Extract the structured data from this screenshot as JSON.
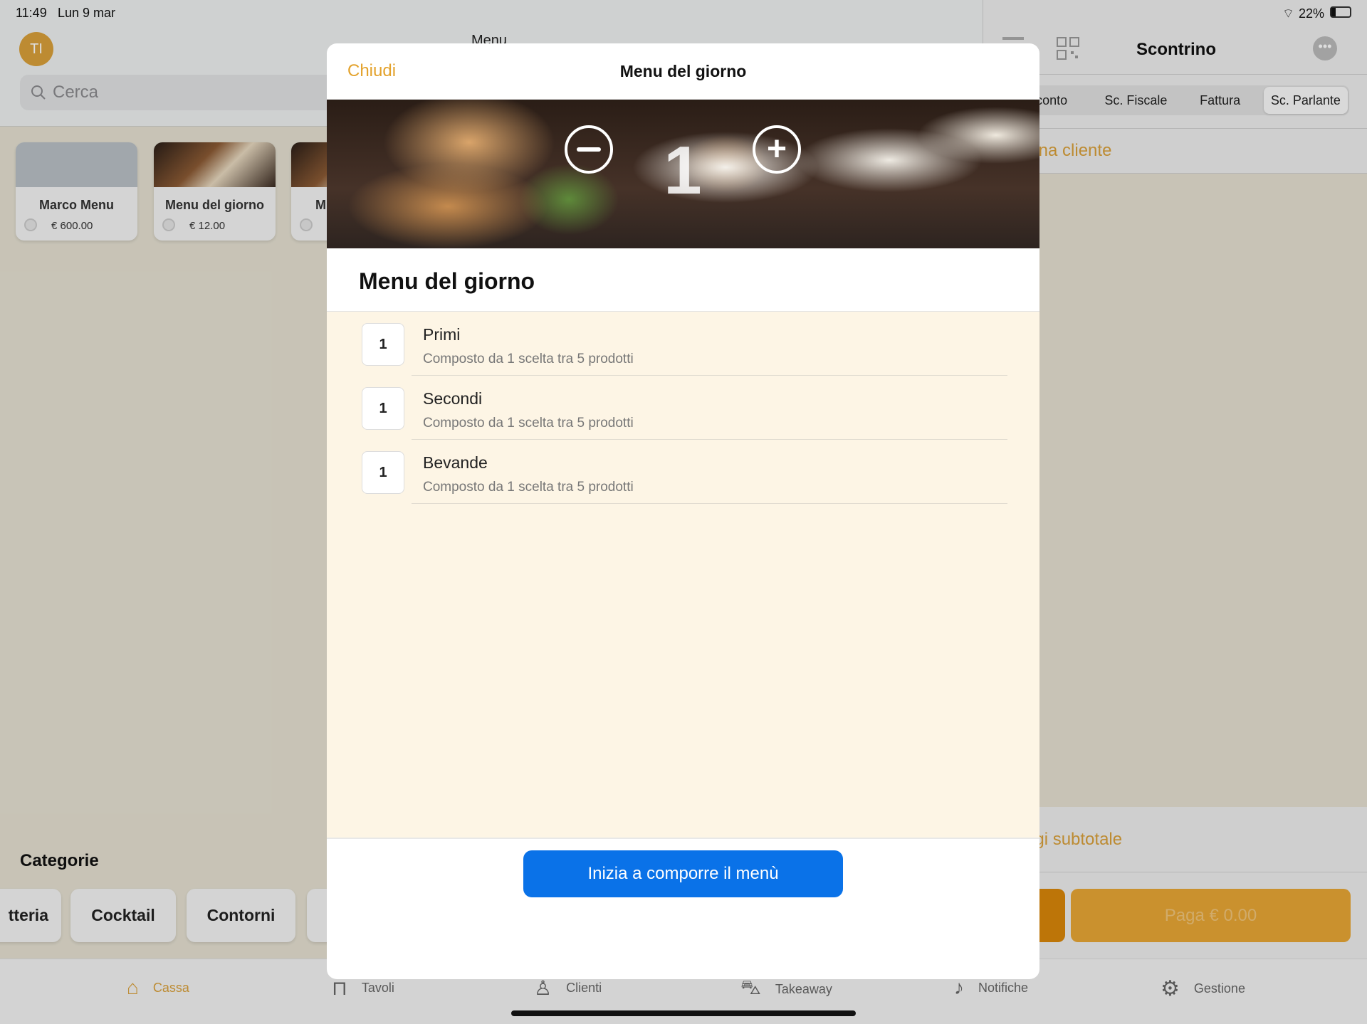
{
  "status_bar": {
    "time": "11:49",
    "date": "Lun 9 mar",
    "battery": "22%",
    "battery_level": 0.22
  },
  "left": {
    "avatar": "TI",
    "header_title": "Menu",
    "search_placeholder": "Cerca",
    "products": [
      {
        "name": "Marco Menu",
        "price": "€ 600.00"
      },
      {
        "name": "Menu del giorno",
        "price": "€ 12.00"
      },
      {
        "name": "M",
        "price": ""
      }
    ],
    "categories_title": "Categorie",
    "categories": [
      "tteria",
      "Cocktail",
      "Contorni",
      ""
    ]
  },
  "right": {
    "title": "Scontrino",
    "segments": [
      "conto",
      "Sc. Fiscale",
      "Fattura",
      "Sc. Parlante"
    ],
    "selected_segment": "Sc. Parlante",
    "customer_link": "iona cliente",
    "subtotal_link": "ngi subtotale",
    "pay_button": "Paga € 0.00"
  },
  "tabbar": [
    {
      "label": "Cassa",
      "icon": "basket-icon",
      "active": true
    },
    {
      "label": "Tavoli",
      "icon": "table-icon"
    },
    {
      "label": "Clienti",
      "icon": "person-icon"
    },
    {
      "label": "Takeaway",
      "icon": "cart-icon"
    },
    {
      "label": "Notifiche",
      "icon": "bell-icon"
    },
    {
      "label": "Gestione",
      "icon": "gear-icon"
    }
  ],
  "modal": {
    "close": "Chiudi",
    "title": "Menu del giorno",
    "quantity": "1",
    "section_title": "Menu del giorno",
    "items": [
      {
        "qty": "1",
        "name": "Primi",
        "desc": "Composto da 1 scelta tra 5 prodotti"
      },
      {
        "qty": "1",
        "name": "Secondi",
        "desc": "Composto da 1 scelta tra 5 prodotti"
      },
      {
        "qty": "1",
        "name": "Bevande",
        "desc": "Composto da 1 scelta tra 5 prodotti"
      }
    ],
    "cta": "Inizia a comporre il menù"
  },
  "colors": {
    "accent": "#d9a03a",
    "primary": "#0a72e8",
    "list_bg": "#fdf5e5"
  }
}
